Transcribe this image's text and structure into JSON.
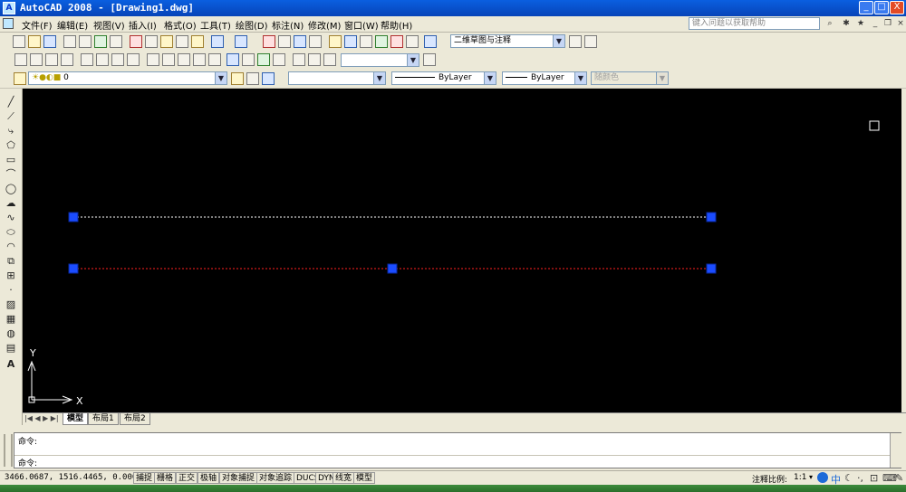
{
  "window": {
    "logo": "A",
    "title": "AutoCAD 2008 - [Drawing1.dwg]",
    "btn_min": "_",
    "btn_max": "□",
    "btn_close": "X"
  },
  "menu": {
    "items": [
      "文件(F)",
      "编辑(E)",
      "视图(V)",
      "插入(I)",
      "格式(O)",
      "工具(T)",
      "绘图(D)",
      "标注(N)",
      "修改(M)",
      "窗口(W)",
      "帮助(H)"
    ],
    "help_placeholder": "键入问题以获取帮助"
  },
  "toolbars": {
    "workspace": "二维草图与注释",
    "layer": "0",
    "linetype": "ByLayer",
    "lineweight": "ByLayer",
    "plotstyle": "随颜色"
  },
  "left_tools": [
    "line-icon",
    "construction-line-icon",
    "polyline-icon",
    "polygon-icon",
    "rectangle-icon",
    "arc-icon",
    "circle-icon",
    "revision-cloud-icon",
    "spline-icon",
    "ellipse-icon",
    "ellipse-arc-icon",
    "insert-block-icon",
    "make-block-icon",
    "point-icon",
    "hatch-icon",
    "gradient-icon",
    "region-icon",
    "table-icon",
    "multiline-text-icon"
  ],
  "canvas": {
    "colors": {
      "background": "#000000",
      "grip": "#1b4cff",
      "line_white": "#ffffff",
      "line_red": "#ff2020"
    },
    "ucs_x": "X",
    "ucs_y": "Y"
  },
  "tabs": {
    "items": [
      "模型",
      "布局1",
      "布局2"
    ],
    "active": "模型"
  },
  "command": {
    "line1": "命令:",
    "line2": "命令:"
  },
  "status": {
    "coords": "3466.0687, 1516.4465, 0.0000",
    "buttons": [
      "捕捉",
      "栅格",
      "正交",
      "极轴",
      "对象捕捉",
      "对象追踪",
      "DUCS",
      "DYN",
      "线宽",
      "模型"
    ],
    "annotation_scale_label": "注释比例:",
    "annotation_scale_value": "1:1"
  }
}
